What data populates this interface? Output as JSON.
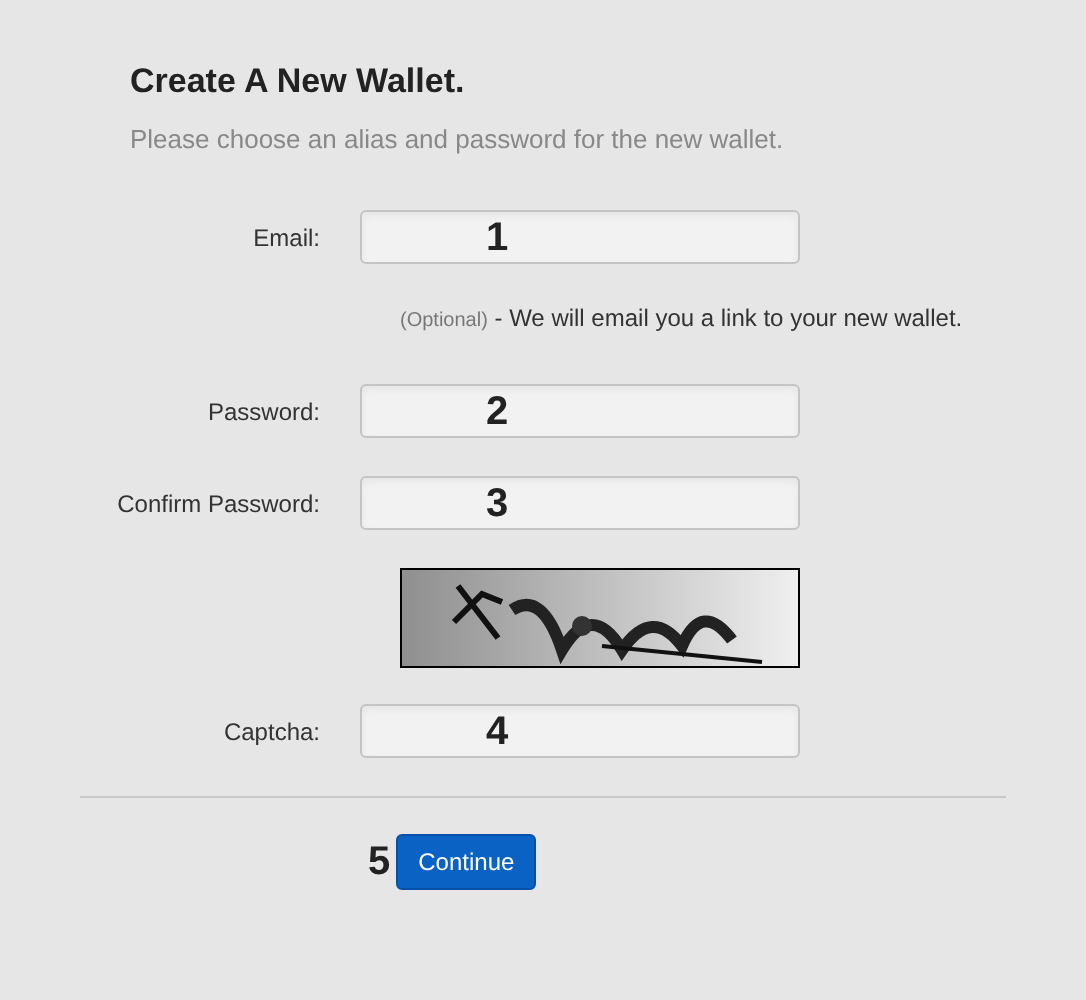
{
  "title": "Create A New Wallet.",
  "subtitle": "Please choose an alias and password for the new wallet.",
  "rows": [
    {
      "kind": "field",
      "label": "Email:",
      "annotation": "1"
    },
    {
      "kind": "note",
      "hint": "(Optional)",
      "text": " - We will email you a link to your new wallet."
    },
    {
      "kind": "field",
      "label": "Password:",
      "annotation": "2"
    },
    {
      "kind": "field",
      "label": "Confirm Password:",
      "annotation": "3"
    },
    {
      "kind": "picture"
    },
    {
      "kind": "field",
      "label": "Captcha:",
      "annotation": "4"
    }
  ],
  "submit": {
    "label": "Continue",
    "annotation": "5"
  }
}
